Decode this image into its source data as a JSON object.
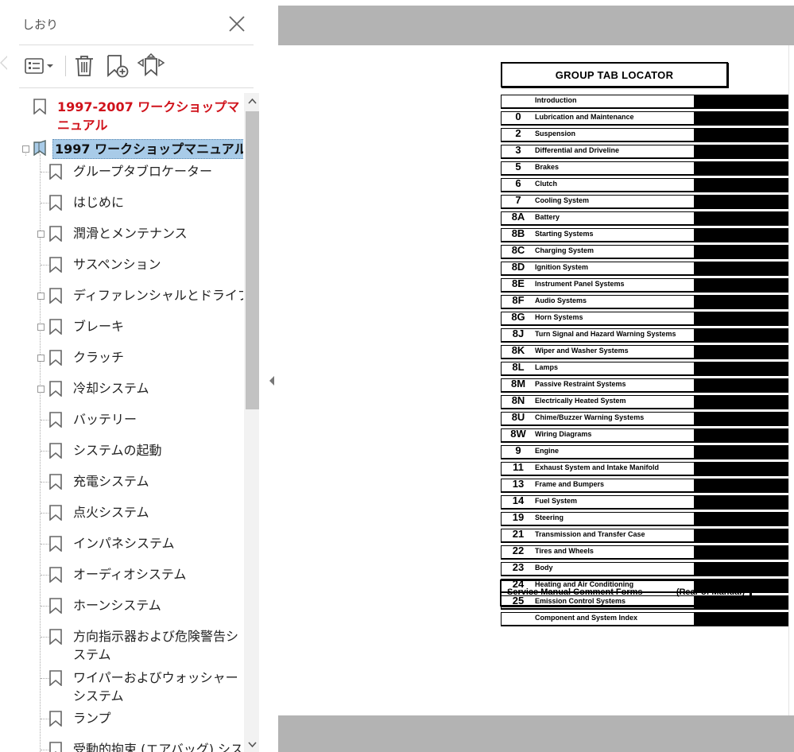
{
  "panel": {
    "title": "しおり",
    "bookmarks": [
      {
        "label": "1997-2007 ワークショップマニュアル",
        "level": 0
      },
      {
        "label": "1997 ワークショップマニュアル",
        "level": 0,
        "selected": true
      },
      {
        "label": "グループタブロケーター",
        "level": 1
      },
      {
        "label": "はじめに",
        "level": 1
      },
      {
        "label": "潤滑とメンテナンス",
        "level": 1
      },
      {
        "label": "サスペンション",
        "level": 1
      },
      {
        "label": "ディファレンシャルとドライブライン",
        "level": 1
      },
      {
        "label": "ブレーキ",
        "level": 1
      },
      {
        "label": "クラッチ",
        "level": 1
      },
      {
        "label": "冷却システム",
        "level": 1
      },
      {
        "label": "バッテリー",
        "level": 1
      },
      {
        "label": "システムの起動",
        "level": 1
      },
      {
        "label": "充電システム",
        "level": 1
      },
      {
        "label": "点火システム",
        "level": 1
      },
      {
        "label": "インパネシステム",
        "level": 1
      },
      {
        "label": "オーディオシステム",
        "level": 1
      },
      {
        "label": "ホーンシステム",
        "level": 1
      },
      {
        "label": "方向指示器および危険警告システム",
        "level": 1
      },
      {
        "label": "ワイパーおよびウォッシャー システム",
        "level": 1
      },
      {
        "label": "ランプ",
        "level": 1
      },
      {
        "label": "受動的拘束 (エアバッグ) システム",
        "level": 1
      }
    ]
  },
  "document": {
    "heading": "GROUP TAB LOCATOR",
    "tabs": [
      {
        "code": "",
        "name": "Introduction"
      },
      {
        "code": "0",
        "name": "Lubrication and Maintenance"
      },
      {
        "code": "2",
        "name": "Suspension"
      },
      {
        "code": "3",
        "name": "Differential and Driveline"
      },
      {
        "code": "5",
        "name": "Brakes"
      },
      {
        "code": "6",
        "name": "Clutch"
      },
      {
        "code": "7",
        "name": "Cooling System"
      },
      {
        "code": "8A",
        "name": "Battery"
      },
      {
        "code": "8B",
        "name": "Starting Systems"
      },
      {
        "code": "8C",
        "name": "Charging System"
      },
      {
        "code": "8D",
        "name": "Ignition System"
      },
      {
        "code": "8E",
        "name": "Instrument Panel Systems"
      },
      {
        "code": "8F",
        "name": "Audio Systems"
      },
      {
        "code": "8G",
        "name": "Horn Systems"
      },
      {
        "code": "8J",
        "name": "Turn Signal and Hazard Warning Systems"
      },
      {
        "code": "8K",
        "name": "Wiper and Washer Systems"
      },
      {
        "code": "8L",
        "name": "Lamps"
      },
      {
        "code": "8M",
        "name": "Passive Restraint Systems"
      },
      {
        "code": "8N",
        "name": "Electrically Heated System"
      },
      {
        "code": "8U",
        "name": "Chime/Buzzer Warning Systems"
      },
      {
        "code": "8W",
        "name": "Wiring Diagrams"
      },
      {
        "code": "9",
        "name": "Engine"
      },
      {
        "code": "11",
        "name": "Exhaust System and Intake Manifold"
      },
      {
        "code": "13",
        "name": "Frame and Bumpers"
      },
      {
        "code": "14",
        "name": "Fuel System"
      },
      {
        "code": "19",
        "name": "Steering"
      },
      {
        "code": "21",
        "name": "Transmission and Transfer Case"
      },
      {
        "code": "22",
        "name": "Tires and Wheels"
      },
      {
        "code": "23",
        "name": "Body"
      },
      {
        "code": "24",
        "name": "Heating and Air Conditioning"
      },
      {
        "code": "25",
        "name": "Emission Control Systems"
      },
      {
        "code": "",
        "name": "Component and System Index"
      }
    ],
    "footer_left": "Service Manual Comment Forms",
    "footer_right": "(Rear of Manual)"
  },
  "icons": {
    "close": "close-icon",
    "options": "list-options-icon",
    "delete": "trash-icon",
    "new_bookmark": "add-bookmark-icon",
    "expand": "expand-bookmark-icon",
    "collapse": "collapse-panel-icon"
  },
  "colors": {
    "root_bookmark_text": "#d0121b",
    "selected_highlight": "#a8cbe8",
    "page_gray": "#b3b3b3"
  }
}
